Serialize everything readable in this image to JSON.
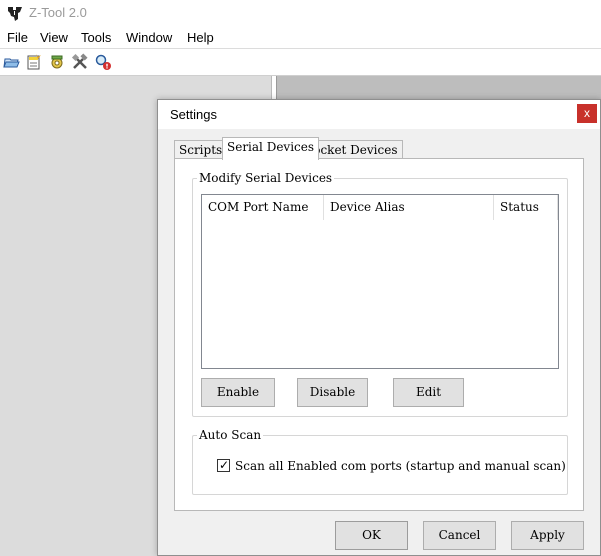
{
  "app": {
    "title": "Z-Tool 2.0",
    "menu": [
      "File",
      "View",
      "Tools",
      "Window",
      "Help"
    ],
    "toolbar_icons": [
      "open-folder-icon",
      "new-document-icon",
      "gear-script-icon",
      "tools-icon",
      "search-alert-icon"
    ]
  },
  "dialog": {
    "title": "Settings",
    "close_glyph": "x",
    "tabs": [
      "Scripts",
      "Serial Devices",
      "Socket Devices"
    ],
    "active_tab": "Serial Devices",
    "modify_group": {
      "label": "Modify Serial Devices",
      "columns": [
        "COM Port Name",
        "Device Alias",
        "Status"
      ],
      "rows": [],
      "buttons": {
        "enable": "Enable",
        "disable": "Disable",
        "edit": "Edit"
      }
    },
    "auto_scan": {
      "label": "Auto Scan",
      "checkbox_label": "Scan all Enabled com ports (startup and manual scan)",
      "checked": true,
      "check_glyph": "✓"
    },
    "footer": {
      "ok": "OK",
      "cancel": "Cancel",
      "apply": "Apply"
    }
  },
  "colors": {
    "close_button": "#c8312b",
    "dialog_bg": "#f0f0f0",
    "button_bg": "#e1e1e1",
    "title_text": "#9a9a9a"
  }
}
